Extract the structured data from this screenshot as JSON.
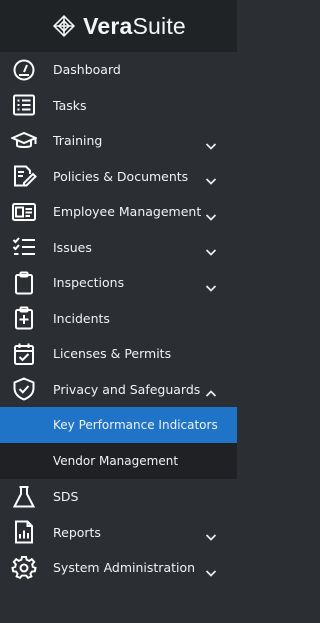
{
  "brand": {
    "name_bold": "Vera",
    "name_light": "Suite"
  },
  "menu": [
    {
      "label": "Dashboard",
      "icon": "dashboard-icon",
      "expandable": false
    },
    {
      "label": "Tasks",
      "icon": "tasks-icon",
      "expandable": false
    },
    {
      "label": "Training",
      "icon": "graduation-cap-icon",
      "expandable": true,
      "expanded": false
    },
    {
      "label": "Policies & Documents",
      "icon": "document-edit-icon",
      "expandable": true,
      "expanded": false
    },
    {
      "label": "Employee Management",
      "icon": "id-card-icon",
      "expandable": true,
      "expanded": false
    },
    {
      "label": "Issues",
      "icon": "checklist-icon",
      "expandable": true,
      "expanded": false
    },
    {
      "label": "Inspections",
      "icon": "clipboard-icon",
      "expandable": true,
      "expanded": false
    },
    {
      "label": "Incidents",
      "icon": "medical-clipboard-icon",
      "expandable": false
    },
    {
      "label": "Licenses & Permits",
      "icon": "calendar-check-icon",
      "expandable": false
    },
    {
      "label": "Privacy and Safeguards",
      "icon": "shield-check-icon",
      "expandable": true,
      "expanded": true,
      "children": [
        {
          "label": "Key Performance Indicators",
          "active": true
        },
        {
          "label": "Vendor Management",
          "active": false
        }
      ]
    },
    {
      "label": "SDS",
      "icon": "flask-icon",
      "expandable": false
    },
    {
      "label": "Reports",
      "icon": "report-icon",
      "expandable": true,
      "expanded": false
    },
    {
      "label": "System Administration",
      "icon": "gear-icon",
      "expandable": true,
      "expanded": false
    }
  ],
  "colors": {
    "sidebar_bg": "#2b2e33",
    "logo_bg": "#202326",
    "active_bg": "#1f74c8",
    "submenu_bg": "#1f2124"
  }
}
